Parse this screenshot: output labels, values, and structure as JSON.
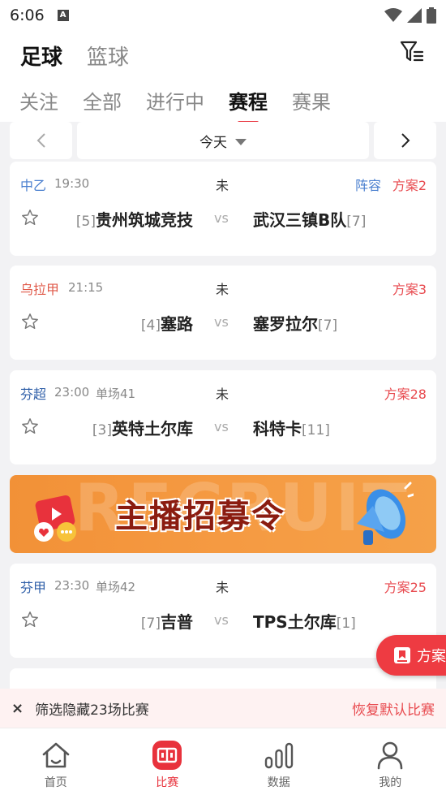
{
  "status_bar": {
    "time": "6:06",
    "notif_letter": "A"
  },
  "sport_tabs": [
    {
      "label": "足球",
      "active": true
    },
    {
      "label": "篮球",
      "active": false
    }
  ],
  "sub_tabs": [
    {
      "label": "关注"
    },
    {
      "label": "全部"
    },
    {
      "label": "进行中"
    },
    {
      "label": "赛程",
      "active": true
    },
    {
      "label": "赛果"
    }
  ],
  "date_bar": {
    "label": "今天",
    "prev": "‹",
    "next": "›"
  },
  "matches": [
    {
      "league": "中乙",
      "league_color": "#4a7fcf",
      "time": "19:30",
      "round": "",
      "status": "未",
      "lineup": "阵容",
      "plan": "方案2",
      "home_rank": "[5]",
      "home": "贵州筑城竞技",
      "vs": "vs",
      "away": "武汉三镇B队",
      "away_rank": "[7]"
    },
    {
      "league": "乌拉甲",
      "league_color": "#e05a4a",
      "time": "21:15",
      "round": "",
      "status": "未",
      "lineup": "",
      "plan": "方案3",
      "home_rank": "[4]",
      "home": "塞路",
      "vs": "vs",
      "away": "塞罗拉尔",
      "away_rank": "[7]"
    },
    {
      "league": "芬超",
      "league_color": "#2f5fa8",
      "time": "23:00",
      "round": "单场41",
      "status": "未",
      "lineup": "",
      "plan": "方案28",
      "home_rank": "[3]",
      "home": "英特土尔库",
      "vs": "vs",
      "away": "科特卡",
      "away_rank": "[11]"
    },
    {
      "league": "芬甲",
      "league_color": "#2f5fa8",
      "time": "23:30",
      "round": "单场42",
      "status": "未",
      "lineup": "",
      "plan": "方案25",
      "home_rank": "[7]",
      "home": "吉普",
      "vs": "vs",
      "away": "TPS土尔库",
      "away_rank": "[1]"
    }
  ],
  "banner": {
    "bg_word": "RECRUIT",
    "title": "主播招募令"
  },
  "float_button": {
    "label": "方案"
  },
  "hidden_bar": {
    "close": "×",
    "text": "筛选隐藏23场比赛",
    "restore": "恢复默认比赛"
  },
  "bottom_nav": [
    {
      "label": "首页",
      "icon": "home-icon"
    },
    {
      "label": "比赛",
      "icon": "match-icon",
      "active": true
    },
    {
      "label": "数据",
      "icon": "data-icon"
    },
    {
      "label": "我的",
      "icon": "profile-icon"
    }
  ],
  "colors": {
    "accent": "#e8323c",
    "plan": "#e84a4f",
    "lineup": "#4a7fcf"
  }
}
